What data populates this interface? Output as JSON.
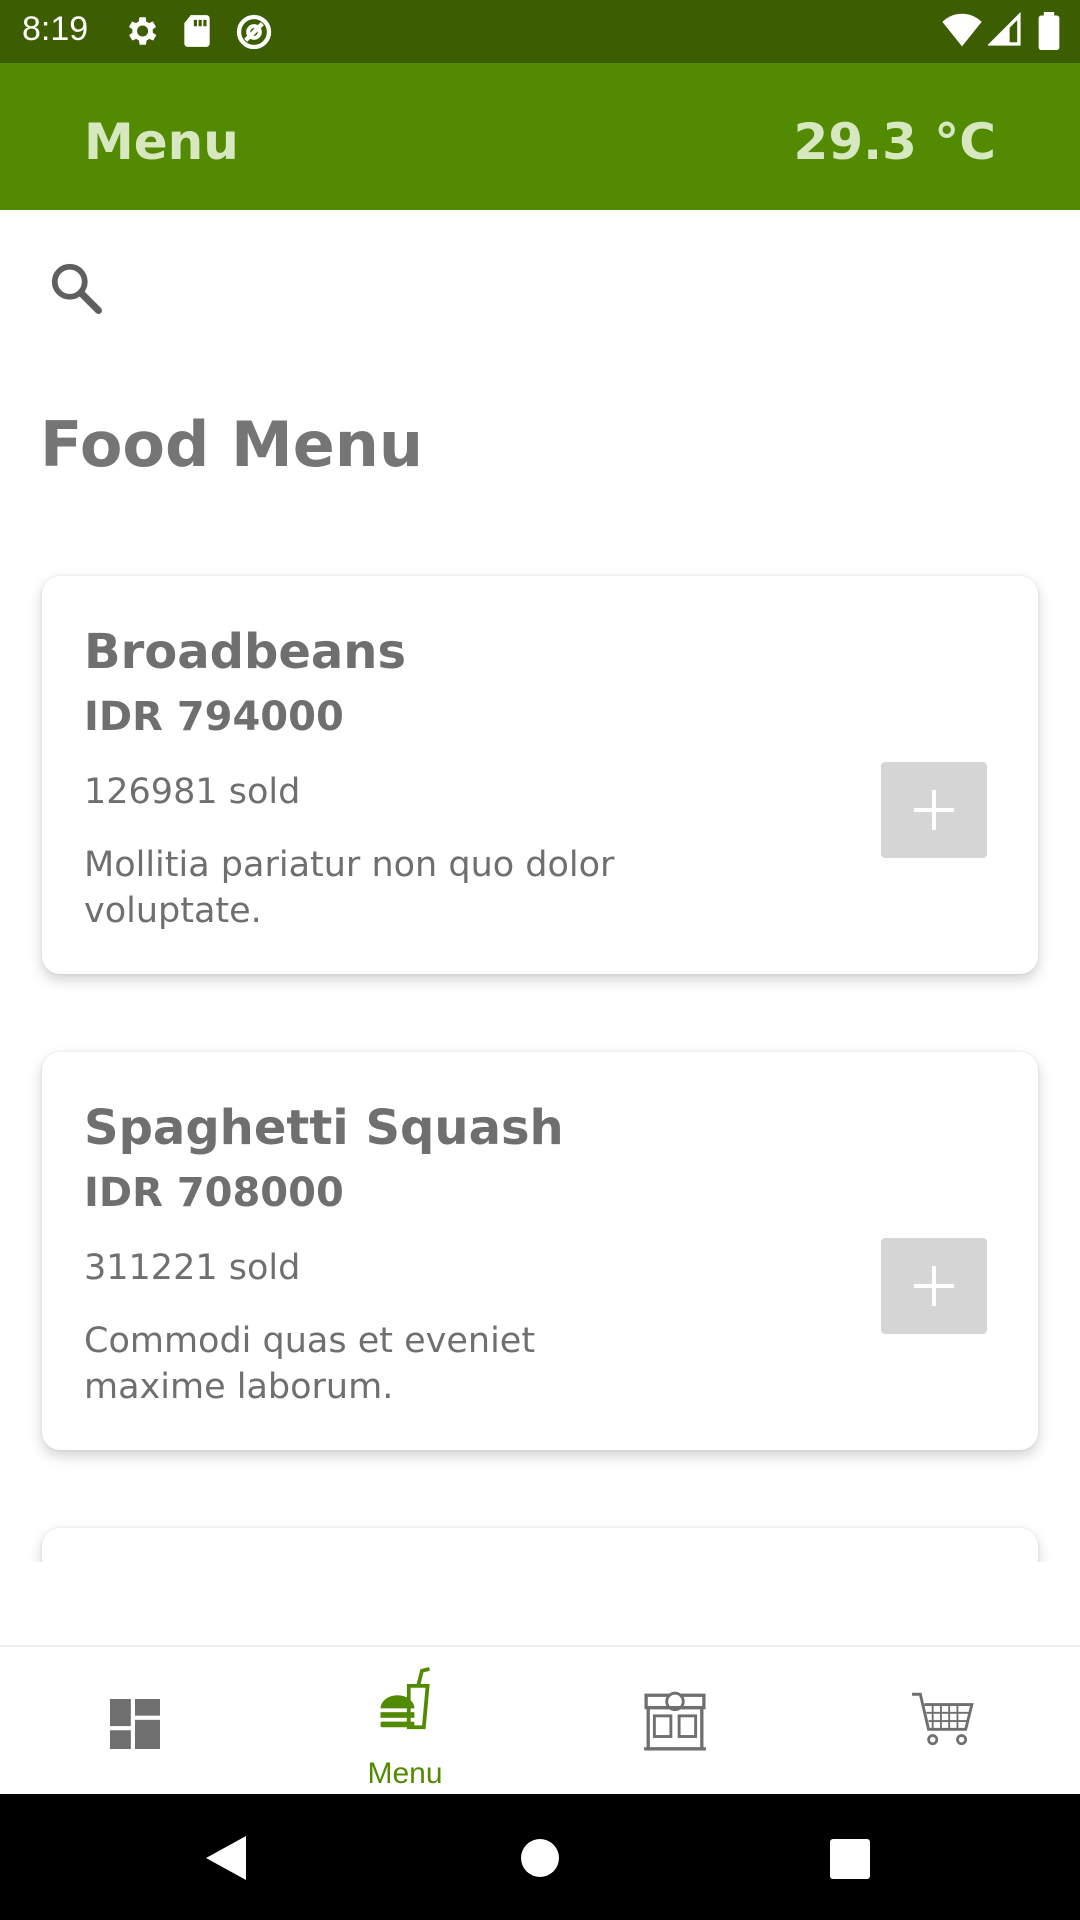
{
  "status_bar": {
    "time": "8:19",
    "left_icons": [
      "gear-icon",
      "sd-card-icon",
      "sync-icon"
    ],
    "right_icons": [
      "wifi-icon",
      "signal-icon",
      "battery-icon"
    ]
  },
  "app_bar": {
    "title": "Menu",
    "temperature": "29.3 °C"
  },
  "search": {
    "icon": "search-icon"
  },
  "section_title": "Food Menu",
  "menu_items": [
    {
      "name": "Broadbeans",
      "price": "IDR 794000",
      "sold": "126981 sold",
      "description": "Mollitia pariatur non quo dolor voluptate."
    },
    {
      "name": "Spaghetti Squash",
      "price": "IDR 708000",
      "sold": "311221 sold",
      "description": "Commodi quas et eveniet maxime laborum."
    }
  ],
  "bottom_nav": {
    "items": [
      {
        "icon": "dashboard-icon",
        "label": ""
      },
      {
        "icon": "burger-drink-icon",
        "label": "Menu"
      },
      {
        "icon": "store-icon",
        "label": ""
      },
      {
        "icon": "cart-icon",
        "label": ""
      }
    ],
    "selected_index": 1
  },
  "colors": {
    "status_bar": "#3c5e00",
    "app_bar": "#528b02",
    "app_bar_text": "#d7e7bf",
    "accent": "#528b02",
    "text": "#6f6f6f"
  }
}
